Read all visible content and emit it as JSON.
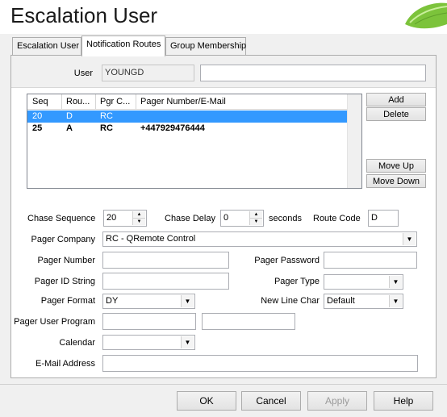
{
  "window": {
    "title": "Escalation User"
  },
  "tabs": [
    {
      "label": "Escalation User"
    },
    {
      "label": "Notification Routes"
    },
    {
      "label": "Group Membership"
    }
  ],
  "user": {
    "label": "User",
    "value": "YOUNGD",
    "extra_value": ""
  },
  "routes": {
    "columns": [
      "Seq",
      "Rou...",
      "Pgr C...",
      "Pager Number/E-Mail"
    ],
    "rows": [
      {
        "seq": "20",
        "route": "D",
        "pgr": "RC",
        "pager": ""
      },
      {
        "seq": "25",
        "route": "A",
        "pgr": "RC",
        "pager": "+447929476444"
      }
    ],
    "buttons": {
      "add": "Add",
      "delete": "Delete",
      "move_up": "Move Up",
      "move_down": "Move Down"
    }
  },
  "form": {
    "chase_sequence": {
      "label": "Chase Sequence",
      "value": "20"
    },
    "chase_delay": {
      "label": "Chase Delay",
      "value": "0",
      "unit": "seconds"
    },
    "route_code": {
      "label": "Route Code",
      "value": "D"
    },
    "pager_company": {
      "label": "Pager Company",
      "value": "RC - QRemote Control"
    },
    "pager_number": {
      "label": "Pager Number",
      "value": ""
    },
    "pager_password": {
      "label": "Pager Password",
      "value": ""
    },
    "pager_id_string": {
      "label": "Pager ID String",
      "value": ""
    },
    "pager_type": {
      "label": "Pager Type",
      "value": ""
    },
    "pager_format": {
      "label": "Pager Format",
      "value": "DY"
    },
    "new_line_char": {
      "label": "New Line Char",
      "value": "Default"
    },
    "pager_user_program": {
      "label": "Pager User Program",
      "value": "",
      "value2": ""
    },
    "calendar": {
      "label": "Calendar",
      "value": ""
    },
    "email": {
      "label": "E-Mail Address",
      "value": ""
    }
  },
  "dialog_buttons": {
    "ok": "OK",
    "cancel": "Cancel",
    "apply": "Apply",
    "help": "Help"
  }
}
